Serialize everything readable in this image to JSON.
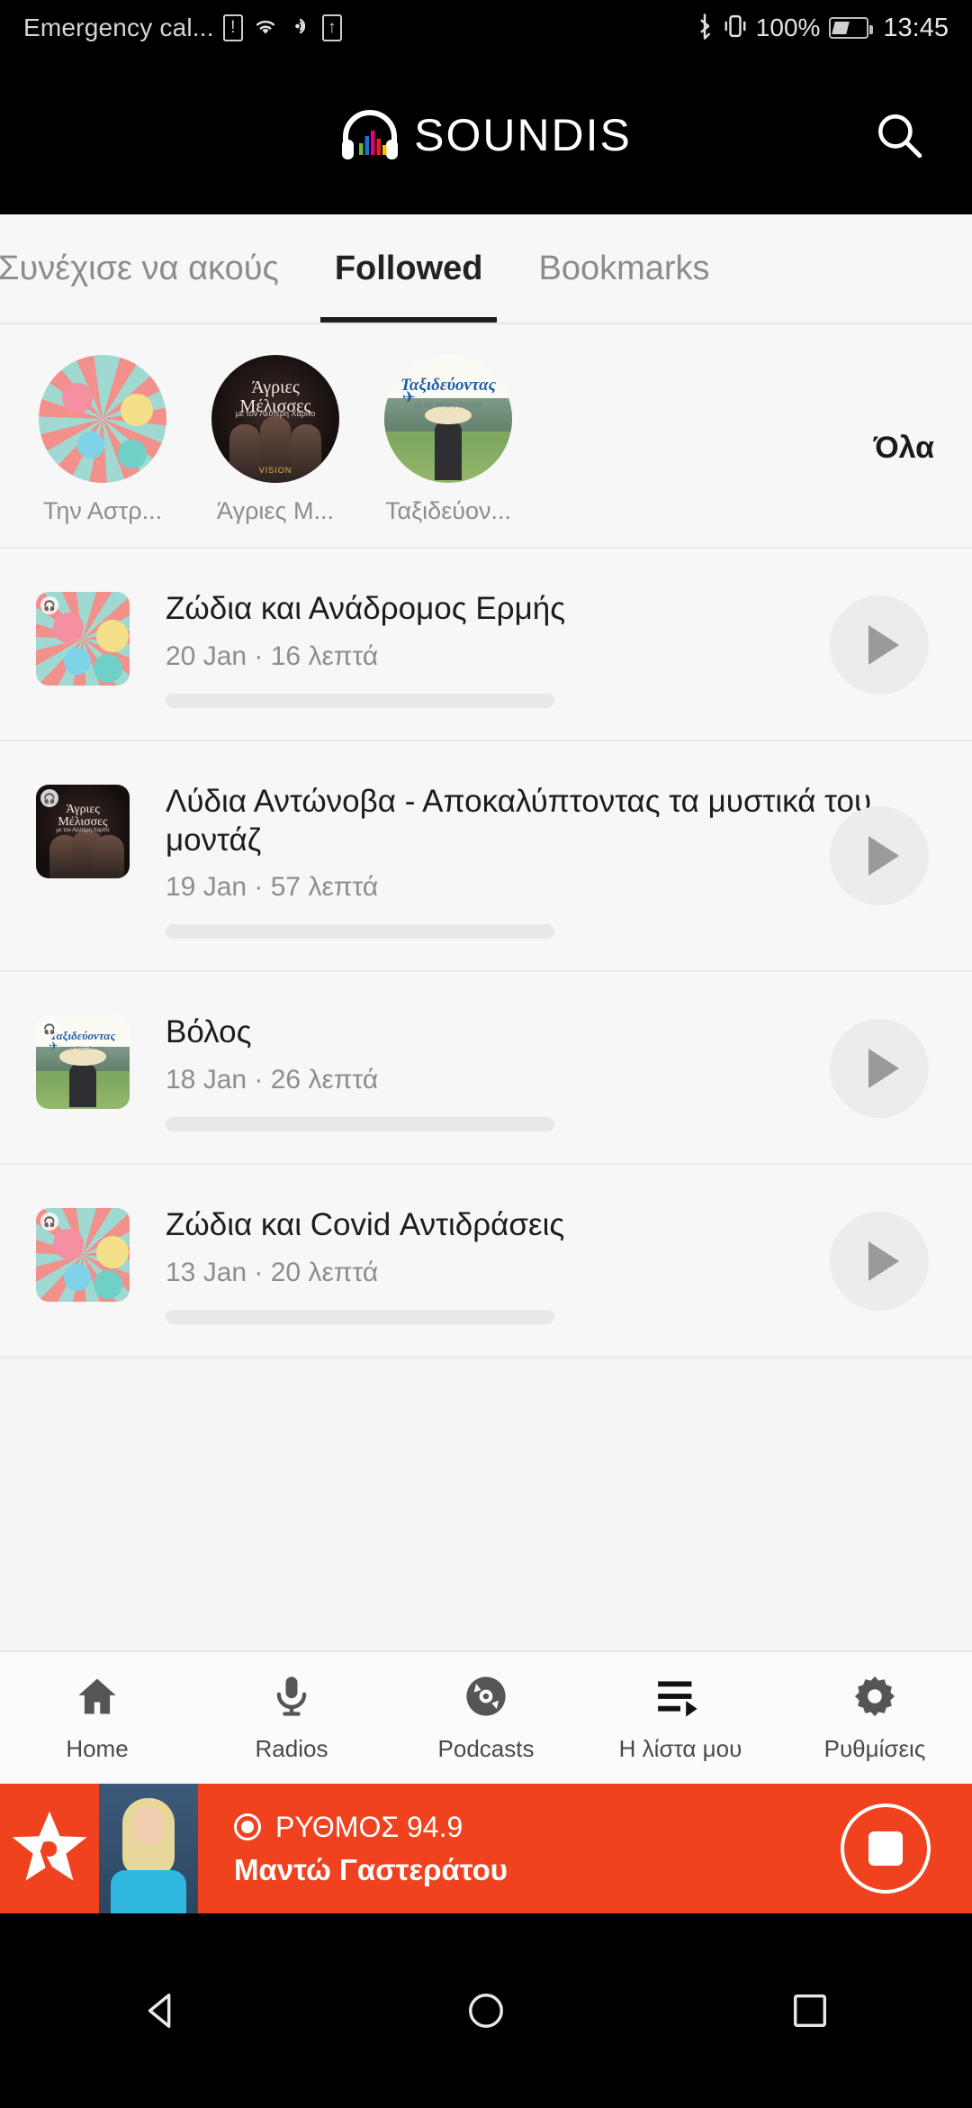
{
  "statusbar": {
    "carrier": "Emergency cal...",
    "icons": [
      "sim-alert-icon",
      "wifi-icon",
      "vibrate-icon",
      "sim-card-icon"
    ],
    "bluetooth_icon": "bluetooth-icon",
    "vibrate_right_icon": "vibrate-icon",
    "battery_percent": "100%",
    "battery_icon": "battery-icon",
    "time": "13:45"
  },
  "appbar": {
    "brand": "SOUNDIS",
    "logo_icon": "headphones-equalizer-logo",
    "search_icon": "search-icon"
  },
  "tabs": [
    {
      "label": "Συνέχισε να ακούς",
      "active": false
    },
    {
      "label": "Followed",
      "active": true
    },
    {
      "label": "Bookmarks",
      "active": false
    }
  ],
  "followed_strip": {
    "all_label": "Όλα",
    "podcasts": [
      {
        "label": "Την Αστρ...",
        "art": "zodiac-wheel-artwork"
      },
      {
        "label": "Άγριες Μ...",
        "art": "agries-melisses-artwork"
      },
      {
        "label": "Ταξιδεύον...",
        "art": "taxidevontas-artwork"
      }
    ]
  },
  "episodes": [
    {
      "title": "Ζώδια και Ανάδρομος Ερμής",
      "date": "20 Jan",
      "separator": "·",
      "duration": "16 λεπτά",
      "meta": "20 Jan · 16 λεπτά",
      "art": "zodiac-wheel-artwork",
      "play_icon": "play-icon"
    },
    {
      "title": "Λύδια Αντώνοβα - Αποκαλύπτοντας τα μυστικά του μοντάζ",
      "date": "19 Jan",
      "separator": "·",
      "duration": "57 λεπτά",
      "meta": "19 Jan · 57 λεπτά",
      "art": "agries-melisses-artwork",
      "play_icon": "play-icon"
    },
    {
      "title": "Βόλος",
      "date": "18 Jan",
      "separator": "·",
      "duration": "26 λεπτά",
      "meta": "18 Jan · 26 λεπτά",
      "art": "taxidevontas-artwork",
      "play_icon": "play-icon"
    },
    {
      "title": "Ζώδια και Covid Αντιδράσεις",
      "date": "13 Jan",
      "separator": "·",
      "duration": "20 λεπτά",
      "meta": "13 Jan · 20 λεπτά",
      "art": "zodiac-wheel-artwork",
      "play_icon": "play-icon"
    }
  ],
  "bottom_nav": [
    {
      "label": "Home",
      "icon": "home-icon"
    },
    {
      "label": "Radios",
      "icon": "microphone-icon"
    },
    {
      "label": "Podcasts",
      "icon": "disc-icon"
    },
    {
      "label": "Η λίστα μου",
      "icon": "playlist-play-icon"
    },
    {
      "label": "Ρυθμίσεις",
      "icon": "gear-icon"
    }
  ],
  "player": {
    "station": "ΡΥΘΜΟΣ 94.9",
    "show": "Μαντώ Γαστεράτου",
    "live_icon": "live-dot-icon",
    "stop_icon": "stop-icon",
    "station_logo_icon": "star-logo-icon",
    "accent_color": "#f0421f"
  },
  "system_nav": {
    "back_icon": "back-triangle-icon",
    "home_icon": "home-circle-icon",
    "recents_icon": "recents-square-icon"
  }
}
